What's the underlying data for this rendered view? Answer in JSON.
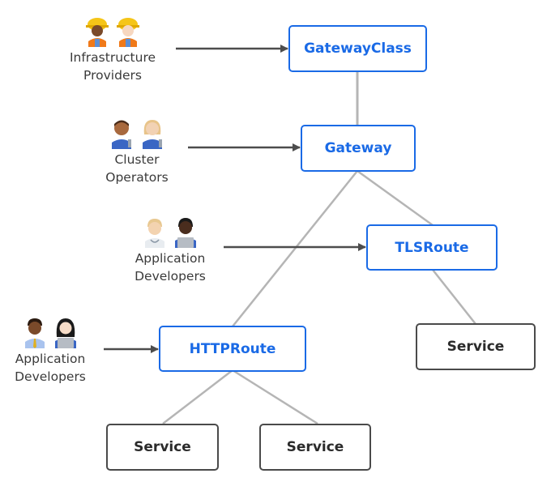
{
  "diagram": {
    "nodes": {
      "gatewayclass": "GatewayClass",
      "gateway": "Gateway",
      "tlsroute": "TLSRoute",
      "httproute": "HTTPRoute",
      "service_tls": "Service",
      "service_http_1": "Service",
      "service_http_2": "Service"
    },
    "actors": {
      "infra": {
        "line1": "Infrastructure",
        "line2": "Providers",
        "icons": [
          "construction-worker-woman-icon",
          "construction-worker-man-icon"
        ]
      },
      "cluster": {
        "line1": "Cluster",
        "line2": "Operators",
        "icons": [
          "mechanic-man-icon",
          "mechanic-woman-icon"
        ]
      },
      "app_tls": {
        "line1": "Application",
        "line2": "Developers",
        "icons": [
          "health-worker-icon",
          "technologist-icon"
        ]
      },
      "app_http": {
        "line1": "Application",
        "line2": "Developers",
        "icons": [
          "office-worker-man-icon",
          "technologist-woman-icon"
        ]
      }
    },
    "colors": {
      "accent": "#1a6ae6",
      "service_border": "#4a4a4a",
      "connector": "#b5b5b5",
      "arrow": "#4d4d4d"
    }
  }
}
